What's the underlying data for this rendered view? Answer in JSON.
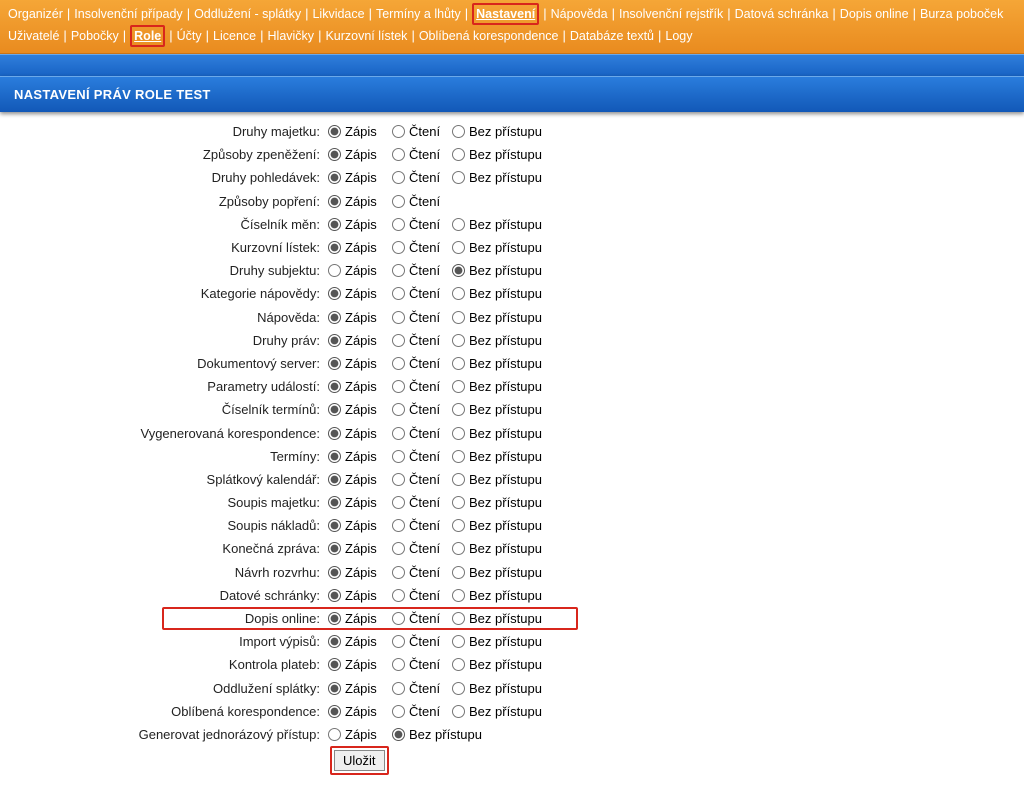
{
  "nav1": [
    {
      "label": "Organizér",
      "active": false
    },
    {
      "label": "Insolvenční případy",
      "active": false
    },
    {
      "label": "Oddlužení - splátky",
      "active": false
    },
    {
      "label": "Likvidace",
      "active": false
    },
    {
      "label": "Termíny a lhůty",
      "active": false
    },
    {
      "label": "Nastavení",
      "active": true,
      "red": true
    },
    {
      "label": "Nápověda",
      "active": false
    },
    {
      "label": "Insolvenční rejstřík",
      "active": false
    },
    {
      "label": "Datová schránka",
      "active": false
    },
    {
      "label": "Dopis online",
      "active": false
    },
    {
      "label": "Burza poboček",
      "active": false
    }
  ],
  "nav2": [
    {
      "label": "Uživatelé",
      "active": false
    },
    {
      "label": "Pobočky",
      "active": false
    },
    {
      "label": "Role",
      "active": true,
      "red": true
    },
    {
      "label": "Účty",
      "active": false
    },
    {
      "label": "Licence",
      "active": false
    },
    {
      "label": "Hlavičky",
      "active": false
    },
    {
      "label": "Kurzovní lístek",
      "active": false
    },
    {
      "label": "Oblíbená korespondence",
      "active": false
    },
    {
      "label": "Databáze textů",
      "active": false
    },
    {
      "label": "Logy",
      "active": false
    }
  ],
  "title": "NASTAVENÍ PRÁV ROLE TEST",
  "option_labels": {
    "zapis": "Zápis",
    "cteni": "Čtení",
    "bez": "Bez přístupu"
  },
  "rows": [
    {
      "name": "druhy-majetku",
      "label": "Druhy majetku:",
      "sel": "zapis",
      "opts": [
        "zapis",
        "cteni",
        "bez"
      ]
    },
    {
      "name": "zpusoby-zpenezeni",
      "label": "Způsoby zpeněžení:",
      "sel": "zapis",
      "opts": [
        "zapis",
        "cteni",
        "bez"
      ]
    },
    {
      "name": "druhy-pohledavek",
      "label": "Druhy pohledávek:",
      "sel": "zapis",
      "opts": [
        "zapis",
        "cteni",
        "bez"
      ]
    },
    {
      "name": "zpusoby-popreni",
      "label": "Způsoby popření:",
      "sel": "zapis",
      "opts": [
        "zapis",
        "cteni"
      ]
    },
    {
      "name": "ciselnik-men",
      "label": "Číselník měn:",
      "sel": "zapis",
      "opts": [
        "zapis",
        "cteni",
        "bez"
      ]
    },
    {
      "name": "kurzovni-listek",
      "label": "Kurzovní lístek:",
      "sel": "zapis",
      "opts": [
        "zapis",
        "cteni",
        "bez"
      ]
    },
    {
      "name": "druhy-subjektu",
      "label": "Druhy subjektu:",
      "sel": "bez",
      "opts": [
        "zapis",
        "cteni",
        "bez"
      ]
    },
    {
      "name": "kategorie-napovedy",
      "label": "Kategorie nápovědy:",
      "sel": "zapis",
      "opts": [
        "zapis",
        "cteni",
        "bez"
      ]
    },
    {
      "name": "napoveda",
      "label": "Nápověda:",
      "sel": "zapis",
      "opts": [
        "zapis",
        "cteni",
        "bez"
      ]
    },
    {
      "name": "druhy-prav",
      "label": "Druhy práv:",
      "sel": "zapis",
      "opts": [
        "zapis",
        "cteni",
        "bez"
      ]
    },
    {
      "name": "dokumentovy-server",
      "label": "Dokumentový server:",
      "sel": "zapis",
      "opts": [
        "zapis",
        "cteni",
        "bez"
      ]
    },
    {
      "name": "parametry-udalosti",
      "label": "Parametry událostí:",
      "sel": "zapis",
      "opts": [
        "zapis",
        "cteni",
        "bez"
      ]
    },
    {
      "name": "ciselnik-terminu",
      "label": "Číselník termínů:",
      "sel": "zapis",
      "opts": [
        "zapis",
        "cteni",
        "bez"
      ]
    },
    {
      "name": "vygenerovana-korespondence",
      "label": "Vygenerovaná korespondence:",
      "sel": "zapis",
      "opts": [
        "zapis",
        "cteni",
        "bez"
      ]
    },
    {
      "name": "terminy",
      "label": "Termíny:",
      "sel": "zapis",
      "opts": [
        "zapis",
        "cteni",
        "bez"
      ]
    },
    {
      "name": "splatkovy-kalendar",
      "label": "Splátkový kalendář:",
      "sel": "zapis",
      "opts": [
        "zapis",
        "cteni",
        "bez"
      ]
    },
    {
      "name": "soupis-majetku",
      "label": "Soupis majetku:",
      "sel": "zapis",
      "opts": [
        "zapis",
        "cteni",
        "bez"
      ]
    },
    {
      "name": "soupis-nakladu",
      "label": "Soupis nákladů:",
      "sel": "zapis",
      "opts": [
        "zapis",
        "cteni",
        "bez"
      ]
    },
    {
      "name": "konecna-zprava",
      "label": "Konečná zpráva:",
      "sel": "zapis",
      "opts": [
        "zapis",
        "cteni",
        "bez"
      ]
    },
    {
      "name": "navrh-rozvrhu",
      "label": "Návrh rozvrhu:",
      "sel": "zapis",
      "opts": [
        "zapis",
        "cteni",
        "bez"
      ]
    },
    {
      "name": "datove-schranky",
      "label": "Datové schránky:",
      "sel": "zapis",
      "opts": [
        "zapis",
        "cteni",
        "bez"
      ]
    },
    {
      "name": "dopis-online",
      "label": "Dopis online:",
      "sel": "zapis",
      "opts": [
        "zapis",
        "cteni",
        "bez"
      ],
      "highlight": true
    },
    {
      "name": "import-vypisu",
      "label": "Import výpisů:",
      "sel": "zapis",
      "opts": [
        "zapis",
        "cteni",
        "bez"
      ]
    },
    {
      "name": "kontrola-plateb",
      "label": "Kontrola plateb:",
      "sel": "zapis",
      "opts": [
        "zapis",
        "cteni",
        "bez"
      ]
    },
    {
      "name": "oddluzeni-splatky",
      "label": "Oddlužení splátky:",
      "sel": "zapis",
      "opts": [
        "zapis",
        "cteni",
        "bez"
      ]
    },
    {
      "name": "oblibena-korespondence",
      "label": "Oblíbená korespondence:",
      "sel": "zapis",
      "opts": [
        "zapis",
        "cteni",
        "bez"
      ]
    },
    {
      "name": "generovat-jednorazovy-pristup",
      "label": "Generovat jednorázový přístup:",
      "sel": "bez",
      "opts": [
        "zapis",
        "bez"
      ]
    }
  ],
  "save_label": "Uložit"
}
